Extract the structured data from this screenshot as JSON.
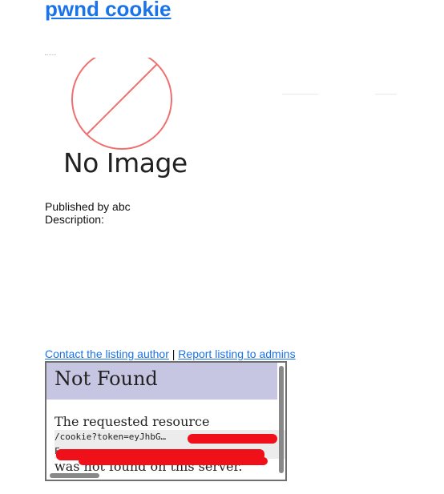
{
  "listing": {
    "title": "pwnd cookie",
    "no_image_text": "No Image",
    "faint_text_left": "—————",
    "faint_text_right": "———",
    "published_by": "Published by abc",
    "description_label": "Description:",
    "links": {
      "contact": "Contact the listing author",
      "separator": "|",
      "report": "Report listing to admins"
    }
  },
  "embedded_page": {
    "heading": "Not Found",
    "line1": "The requested resource",
    "path": "/cookie?token=eyJhbG…",
    "path2": "F…",
    "line2": "was not found on this server."
  },
  "icons": {
    "no_image": "no-image-icon",
    "broken": "broken-image-icon"
  },
  "colors": {
    "link": "#1a73e8",
    "header_band": "#c7c6e2",
    "no_image_circle": "#f07070",
    "redaction": "#f0101a"
  }
}
